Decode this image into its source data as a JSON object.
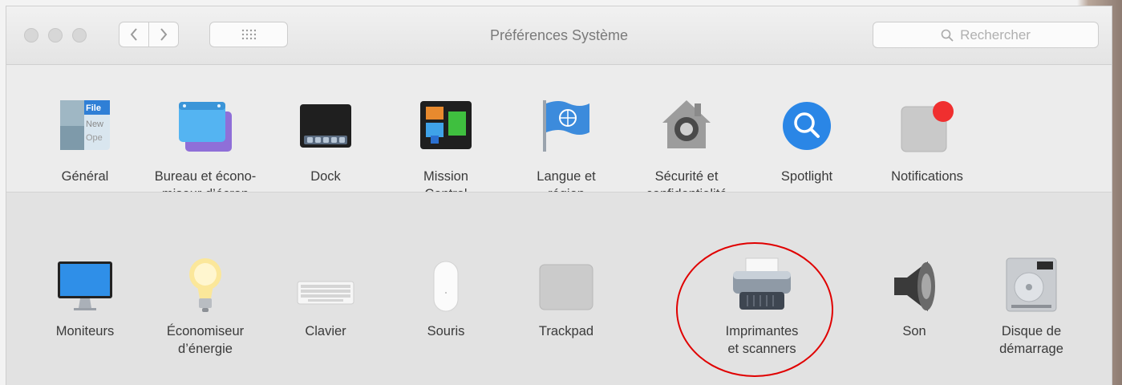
{
  "window": {
    "title": "Préférences Système",
    "search_placeholder": "Rechercher"
  },
  "icons": {
    "back": "chevron-left-icon",
    "forward": "chevron-right-icon",
    "show_all": "grid-icon",
    "search": "search-icon"
  },
  "row1": [
    {
      "label": "Général",
      "icon": "general-icon"
    },
    {
      "label": "Bureau et écono-\nmiseur d’écran",
      "icon": "desktop-screensaver-icon"
    },
    {
      "label": "Dock",
      "icon": "dock-icon"
    },
    {
      "label": "Mission\nControl",
      "icon": "mission-control-icon"
    },
    {
      "label": "Langue et\nrégion",
      "icon": "language-region-icon"
    },
    {
      "label": "Sécurité et\nconfidentialité",
      "icon": "security-privacy-icon"
    },
    {
      "label": "Spotlight",
      "icon": "spotlight-icon"
    },
    {
      "label": "Notifications",
      "icon": "notifications-icon"
    }
  ],
  "row2": [
    {
      "label": "Moniteurs",
      "icon": "displays-icon"
    },
    {
      "label": "Économiseur\nd’énergie",
      "icon": "energy-saver-icon"
    },
    {
      "label": "Clavier",
      "icon": "keyboard-icon"
    },
    {
      "label": "Souris",
      "icon": "mouse-icon"
    },
    {
      "label": "Trackpad",
      "icon": "trackpad-icon"
    },
    {
      "label": "Imprimantes\net scanners",
      "icon": "printer-icon"
    },
    {
      "label": "Son",
      "icon": "sound-icon"
    },
    {
      "label": "Disque de\ndémarrage",
      "icon": "startup-disk-icon"
    }
  ],
  "highlight": {
    "target": "Imprimantes et scanners",
    "color": "#e00000"
  }
}
